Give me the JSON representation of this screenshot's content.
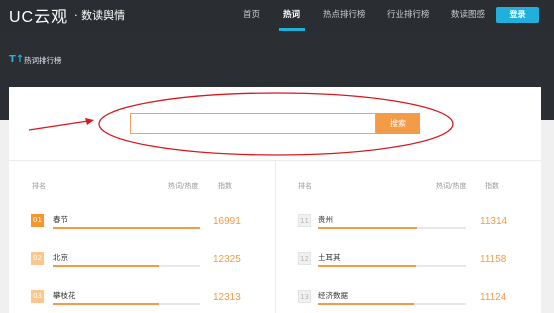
{
  "header": {
    "logo_mark": "UC云观",
    "logo_sub": "· 数读舆情",
    "nav": [
      "首页",
      "热词",
      "热点排行榜",
      "行业排行榜",
      "数读图感"
    ],
    "login_label": "登录"
  },
  "subheader": {
    "icon": "T↑",
    "title": "热词排行榜"
  },
  "search": {
    "placeholder": "",
    "button_label": "搜索"
  },
  "columns": {
    "rank": "排名",
    "heat": "热词/热度",
    "index": "指数"
  },
  "left_rows": [
    {
      "rank": "01",
      "keyword": "春节",
      "index": "16991",
      "level": 1.0
    },
    {
      "rank": "02",
      "keyword": "北京",
      "index": "12325",
      "level": 0.72
    },
    {
      "rank": "03",
      "keyword": "攀枝花",
      "index": "12313",
      "level": 0.72
    }
  ],
  "right_rows": [
    {
      "rank": "11",
      "keyword": "贵州",
      "index": "11314",
      "level": 0.67
    },
    {
      "rank": "12",
      "keyword": "土耳其",
      "index": "11158",
      "level": 0.66
    },
    {
      "rank": "13",
      "keyword": "经济数据",
      "index": "11124",
      "level": 0.65
    }
  ],
  "annotation_color": "#d71920",
  "accent_color": "#f39b46"
}
